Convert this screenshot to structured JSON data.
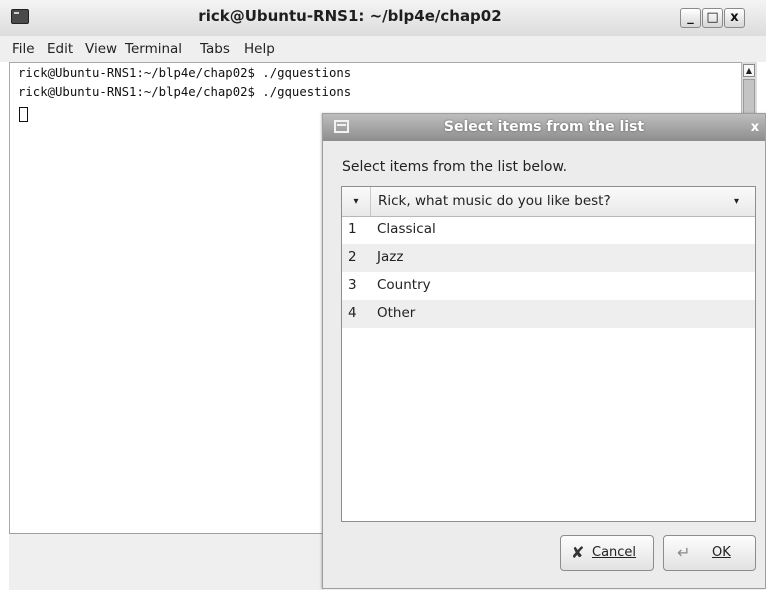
{
  "terminal": {
    "title": "rick@Ubuntu-RNS1: ~/blp4e/chap02",
    "menu": [
      "File",
      "Edit",
      "View",
      "Terminal",
      "Tabs",
      "Help"
    ],
    "lines": [
      "rick@Ubuntu-RNS1:~/blp4e/chap02$ ./gquestions",
      "rick@Ubuntu-RNS1:~/blp4e/chap02$ ./gquestions"
    ],
    "controls": {
      "minimize": "_",
      "maximize": "□",
      "close": "x"
    }
  },
  "dialog": {
    "title": "Select items from the list",
    "close_glyph": "x",
    "prompt": "Select items from the list below.",
    "list_header": {
      "sort_glyph": "▾",
      "label": "Rick, what music do you like best?",
      "dropdown_glyph": "▾"
    },
    "items": [
      {
        "num": "1",
        "label": "Classical"
      },
      {
        "num": "2",
        "label": "Jazz"
      },
      {
        "num": "3",
        "label": "Country"
      },
      {
        "num": "4",
        "label": "Other"
      }
    ],
    "buttons": {
      "cancel": "Cancel",
      "ok": "OK"
    },
    "icons": {
      "cancel": "cross-icon",
      "ok": "return-arrow-icon"
    }
  }
}
